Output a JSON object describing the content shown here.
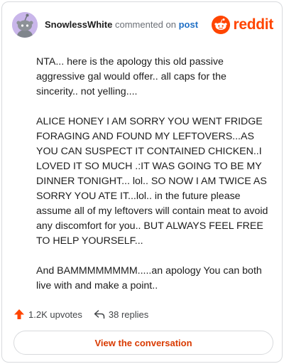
{
  "header": {
    "username": "SnowlessWhite",
    "action": "commented on",
    "post_link": "post",
    "brand": "reddit"
  },
  "comment": {
    "paragraphs": [
      "NTA... here is the apology this old passive aggressive gal would offer.. all caps for the sincerity.. not yelling....",
      "ALICE HONEY I AM SORRY YOU WENT FRIDGE FORAGING AND FOUND MY LEFTOVERS...AS YOU CAN SUSPECT IT CONTAINED CHICKEN..I LOVED IT SO MUCH .:IT WAS GOING TO BE MY DINNER TONIGHT... lol.. SO NOW I AM TWICE AS SORRY YOU ATE IT...lol.. in the future please assume all of my leftovers will contain meat to avoid any discomfort for you.. BUT ALWAYS FEEL FREE TO HELP YOURSELF...",
      "And BAMMMMMMMM.....an apology You can both live with and make a point.."
    ]
  },
  "stats": {
    "upvotes": "1.2K upvotes",
    "replies": "38 replies"
  },
  "actions": {
    "view_conversation": "View the conversation"
  },
  "colors": {
    "brand": "#ff4500",
    "link": "#1f6fc5",
    "button_text": "#d93a00",
    "avatar_bg": "#c9b6ea"
  }
}
